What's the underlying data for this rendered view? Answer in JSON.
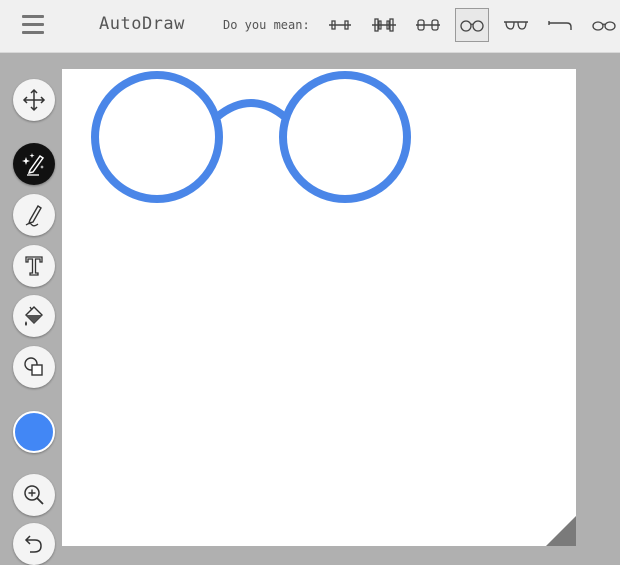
{
  "header": {
    "app_title": "AutoDraw",
    "suggest_label": "Do you mean:",
    "menu_icon": "hamburger-icon"
  },
  "suggestions": [
    {
      "name": "dumbbell-thin",
      "selected": false
    },
    {
      "name": "dumbbell",
      "selected": false
    },
    {
      "name": "dumbbell-rounded",
      "selected": false
    },
    {
      "name": "round-eyeglasses",
      "selected": true
    },
    {
      "name": "sunglasses",
      "selected": false
    },
    {
      "name": "pipe",
      "selected": false
    },
    {
      "name": "eyeglasses",
      "selected": false
    }
  ],
  "tools": [
    {
      "name": "move-tool",
      "icon": "move-arrows-icon",
      "active": false
    },
    {
      "name": "autodraw-tool",
      "icon": "magic-pencil-icon",
      "active": true
    },
    {
      "name": "draw-tool",
      "icon": "pencil-icon",
      "active": false
    },
    {
      "name": "type-tool",
      "icon": "text-t-icon",
      "active": false
    },
    {
      "name": "fill-tool",
      "icon": "paint-bucket-icon",
      "active": false
    },
    {
      "name": "shape-tool",
      "icon": "shapes-icon",
      "active": false
    },
    {
      "name": "zoom-tool",
      "icon": "zoom-in-icon",
      "active": false
    },
    {
      "name": "undo-tool",
      "icon": "undo-icon",
      "active": false
    }
  ],
  "colors": {
    "selected_color": "#4287f5",
    "stroke": "#4a86e8",
    "toolbar_bg": "#f0f0f0",
    "workspace_bg": "#b0b0b0"
  },
  "canvas": {
    "drawing": "round-eyeglasses"
  }
}
